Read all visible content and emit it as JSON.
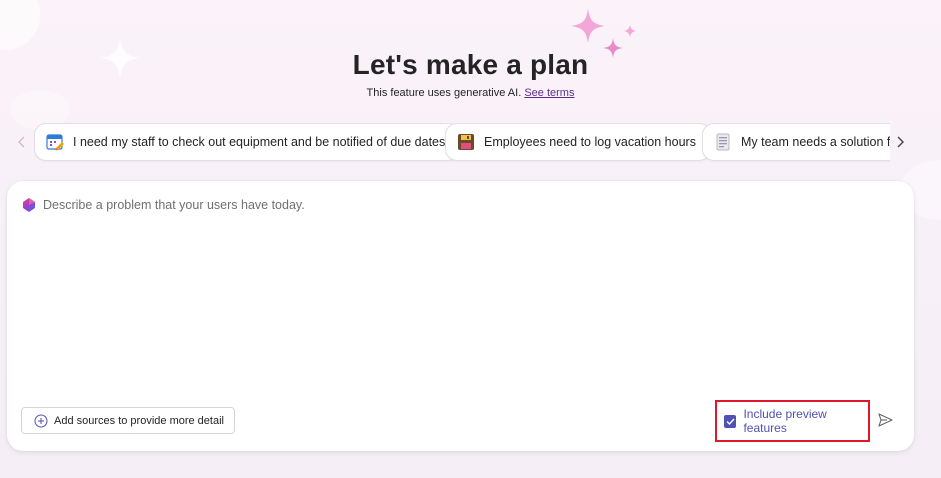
{
  "header": {
    "title": "Let's make a plan",
    "subtitle": "This feature uses generative AI.",
    "terms_link": "See terms"
  },
  "suggestions": [
    {
      "label": "I need my staff to check out equipment and be notified of due dates",
      "icon": "calendar-icon"
    },
    {
      "label": "Employees need to log vacation hours",
      "icon": "floppy-disk-icon"
    },
    {
      "label": "My team needs a solution for",
      "icon": "document-icon"
    }
  ],
  "prompt": {
    "placeholder": "Describe a problem that your users have today.",
    "value": "",
    "add_sources_label": "Add sources to provide more detail",
    "preview_label": "Include preview features",
    "preview_checked": true
  },
  "colors": {
    "accent": "#4f52b2",
    "highlight_border": "#e0162b",
    "link": "#5c2e91"
  }
}
